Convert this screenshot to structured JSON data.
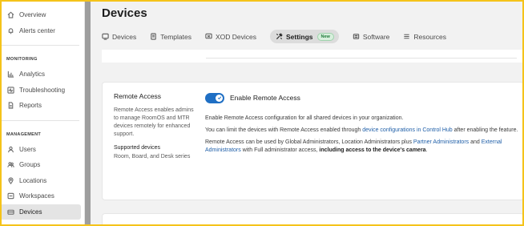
{
  "sidebar": {
    "items_top": [
      {
        "label": "Overview",
        "icon": "home-icon"
      },
      {
        "label": "Alerts center",
        "icon": "bell-icon"
      }
    ],
    "section_monitoring": "MONITORING",
    "items_monitoring": [
      {
        "label": "Analytics",
        "icon": "bar-chart-icon"
      },
      {
        "label": "Troubleshooting",
        "icon": "pulse-icon"
      },
      {
        "label": "Reports",
        "icon": "document-icon"
      }
    ],
    "section_management": "MANAGEMENT",
    "items_management": [
      {
        "label": "Users",
        "icon": "user-icon"
      },
      {
        "label": "Groups",
        "icon": "group-icon"
      },
      {
        "label": "Locations",
        "icon": "location-pin-icon"
      },
      {
        "label": "Workspaces",
        "icon": "workspace-icon"
      },
      {
        "label": "Devices",
        "icon": "device-icon",
        "active": true
      }
    ]
  },
  "header": {
    "title": "Devices"
  },
  "tabs": [
    {
      "label": "Devices",
      "icon": "devices-icon"
    },
    {
      "label": "Templates",
      "icon": "template-icon"
    },
    {
      "label": "XOD Devices",
      "icon": "xod-icon"
    },
    {
      "label": "Settings",
      "icon": "wrench-icon",
      "active": true,
      "badge": "New"
    },
    {
      "label": "Software",
      "icon": "software-icon"
    },
    {
      "label": "Resources",
      "icon": "resources-icon"
    }
  ],
  "remote_access": {
    "title": "Remote Access",
    "description": "Remote Access enables admins to manage RoomOS and MTR devices remotely for enhanced support.",
    "supported_title": "Supported devices",
    "supported_list": "Room, Board, and Desk series",
    "toggle_label": "Enable Remote Access",
    "toggle_on": true,
    "para1": "Enable Remote Access configuration for all shared devices in your organization.",
    "para2_pre": "You can limit the devices with Remote Access enabled through ",
    "para2_link": "device configurations in Control Hub",
    "para2_post": " after enabling the feature.",
    "para3_pre": "Remote Access can be used by Global Administrators, Location Administrators plus ",
    "para3_link1": "Partner Administrators",
    "para3_mid": " and ",
    "para3_link2": "External Administrators",
    "para3_mid2": " with Full administrator access, ",
    "para3_bold": "including access to the device's camera",
    "para3_end": "."
  },
  "colors": {
    "accent": "#1f6fc4",
    "link": "#1f5fa8",
    "badge_bg": "#d8f0dd",
    "frame": "#f5c31a"
  }
}
